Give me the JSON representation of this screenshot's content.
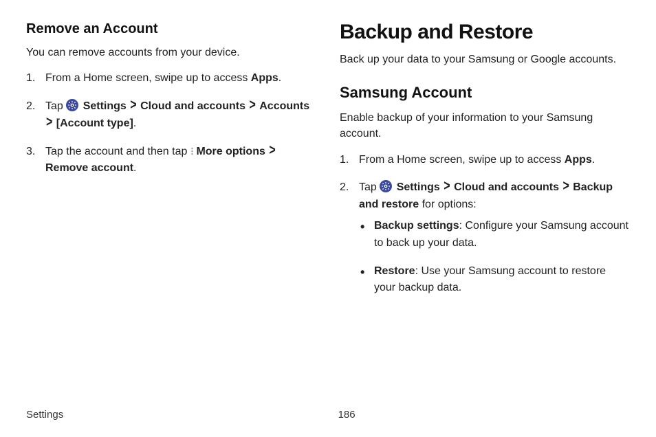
{
  "left": {
    "heading": "Remove an Account",
    "lead": "You can remove accounts from your device.",
    "step1_pre": "From a Home screen, swipe up to access ",
    "step1_bold": "Apps",
    "step1_post": ".",
    "step2_tap": "Tap ",
    "step2_settings": "Settings",
    "step2_cloud": "Cloud and accounts",
    "step2_accounts": "Accounts",
    "step2_accttype": "[Account type]",
    "step2_period": ".",
    "step3_pre": "Tap the account and then tap ",
    "step3_more": "More options",
    "step3_remove": "Remove account",
    "step3_period": "."
  },
  "right": {
    "title": "Backup and Restore",
    "lead": "Back up your data to your Samsung or Google accounts.",
    "sub": "Samsung Account",
    "sub_lead": "Enable backup of your information to your Samsung account.",
    "step1_pre": "From a Home screen, swipe up to access ",
    "step1_bold": "Apps",
    "step1_post": ".",
    "step2_tap": "Tap ",
    "step2_settings": "Settings",
    "step2_cloud": "Cloud and accounts",
    "step2_backup": "Backup and restore",
    "step2_for": " for options:",
    "bullet1_bold": "Backup settings",
    "bullet1_text": ": Configure your Samsung account to back up your data.",
    "bullet2_bold": "Restore",
    "bullet2_text": ": Use your Samsung account to restore your backup data."
  },
  "chev": ">",
  "footer": {
    "section": "Settings",
    "page": "186"
  }
}
